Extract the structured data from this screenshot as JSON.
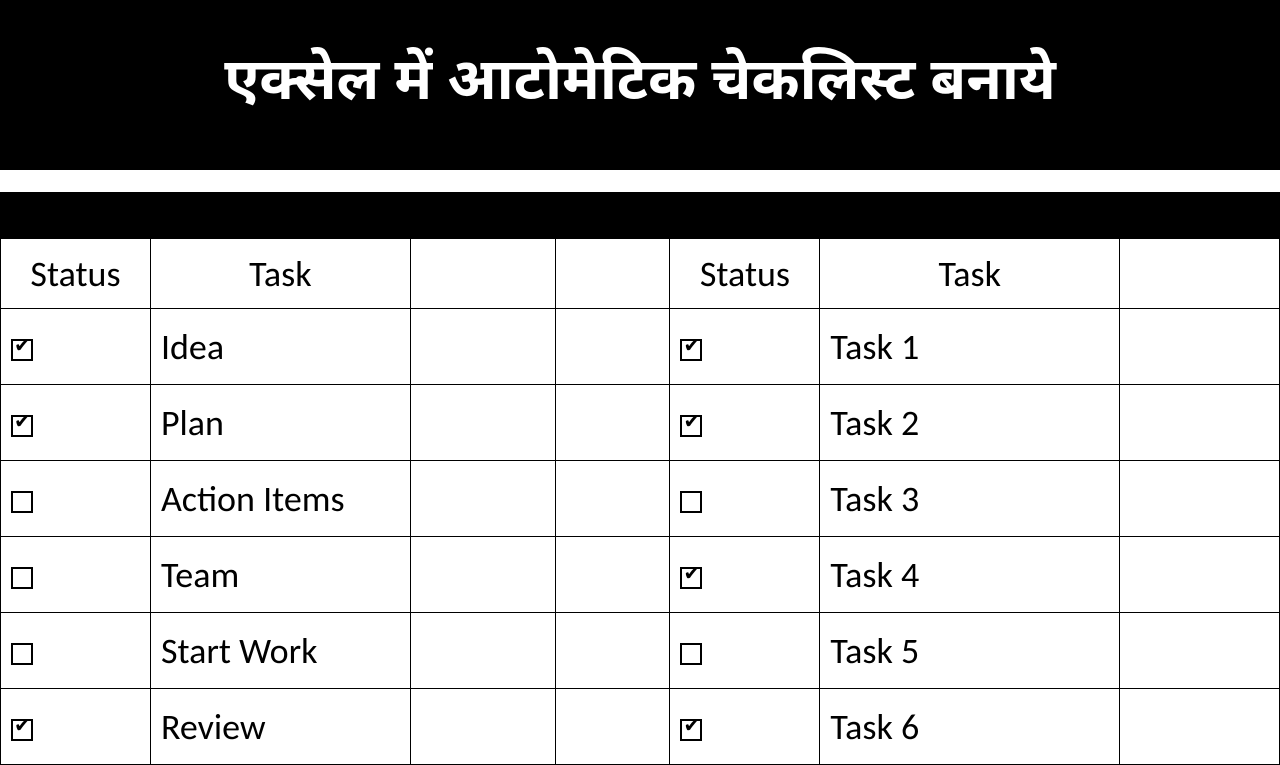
{
  "header": {
    "title": "एक्सेल में आटोमेटिक चेकलिस्ट बनाये"
  },
  "left": {
    "headers": {
      "status": "Status",
      "task": "Task"
    },
    "rows": [
      {
        "checked": true,
        "task": "Idea",
        "highlight": true
      },
      {
        "checked": true,
        "task": "Plan",
        "highlight": true
      },
      {
        "checked": false,
        "task": "Action Items",
        "highlight": false
      },
      {
        "checked": false,
        "task": "Team",
        "highlight": false
      },
      {
        "checked": false,
        "task": "Start Work",
        "highlight": false
      },
      {
        "checked": true,
        "task": "Review",
        "highlight": true
      }
    ]
  },
  "right": {
    "headers": {
      "status": "Status",
      "task": "Task"
    },
    "rows": [
      {
        "checked": true,
        "task": "Task 1",
        "highlight": true
      },
      {
        "checked": true,
        "task": "Task 2",
        "highlight": true
      },
      {
        "checked": false,
        "task": "Task 3",
        "highlight": false
      },
      {
        "checked": true,
        "task": "Task 4",
        "highlight": true
      },
      {
        "checked": false,
        "task": "Task 5",
        "highlight": false
      },
      {
        "checked": true,
        "task": "Task 6",
        "highlight": true
      }
    ]
  },
  "colors": {
    "blue": "#1fa6e6",
    "green": "#1fa83d"
  }
}
